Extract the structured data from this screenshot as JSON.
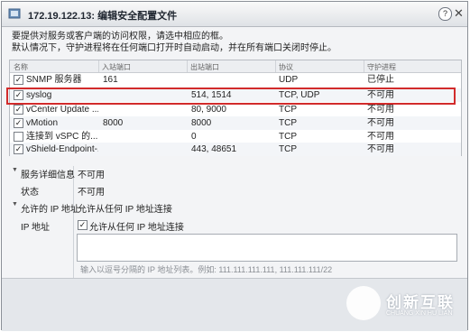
{
  "window": {
    "title": "172.19.122.13: 编辑安全配置文件",
    "help_label": "?",
    "close_label": "✕"
  },
  "intro": {
    "line1": "要提供对服务或客户端的访问权限，请选中相应的框。",
    "line2": "默认情况下，守护进程将在任何端口打开时自动启动，并在所有端口关闭时停止。"
  },
  "table": {
    "headers": [
      "名称",
      "入站端口",
      "出站端口",
      "协议",
      "守护进程"
    ],
    "rows": [
      {
        "checked": "✓",
        "name": "SNMP 服务器",
        "in": "161",
        "out": "",
        "proto": "UDP",
        "daemon": "已停止"
      },
      {
        "checked": "✓",
        "name": "syslog",
        "in": "",
        "out": "514, 1514",
        "proto": "TCP, UDP",
        "daemon": "不可用"
      },
      {
        "checked": "✓",
        "name": "vCenter Update ...",
        "in": "",
        "out": "80, 9000",
        "proto": "TCP",
        "daemon": "不可用"
      },
      {
        "checked": "✓",
        "name": "vMotion",
        "in": "8000",
        "out": "8000",
        "proto": "TCP",
        "daemon": "不可用"
      },
      {
        "checked": "",
        "name": "连接到 vSPC 的...",
        "in": "",
        "out": "0",
        "proto": "TCP",
        "daemon": "不可用"
      },
      {
        "checked": "✓",
        "name": "vShield-Endpoint-...",
        "in": "",
        "out": "443, 48651",
        "proto": "TCP",
        "daemon": "不可用"
      }
    ]
  },
  "details": {
    "service_label": "服务详细信息",
    "service_value": "不可用",
    "status_label": "状态",
    "status_value": "不可用",
    "allowed_label": "允许的 IP 地址",
    "allowed_value": "允许从任何 IP 地址连接",
    "ip_label": "IP 地址",
    "ip_checkbox_label": "允许从任何 IP 地址连接",
    "hint": "输入以逗号分隔的 IP 地址列表。例如: 111.111.111.111, 111.111.111/22"
  },
  "watermark": {
    "line1": "创新互联",
    "line2": "CHUANG XIN HU LIAN"
  }
}
